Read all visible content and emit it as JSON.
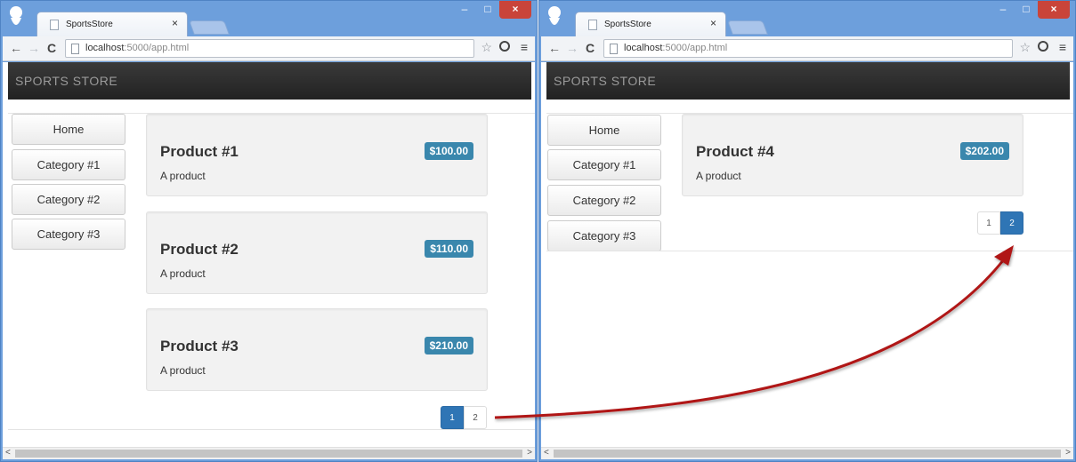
{
  "windows": [
    {
      "tab_title": "SportsStore",
      "url_host": "localhost",
      "url_rest": ":5000/app.html",
      "brand": "SPORTS STORE",
      "categories": [
        "Home",
        "Category #1",
        "Category #2",
        "Category #3"
      ],
      "products": [
        {
          "name": "Product #1",
          "description": "A product",
          "price": "$100.00"
        },
        {
          "name": "Product #2",
          "description": "A product",
          "price": "$110.00"
        },
        {
          "name": "Product #3",
          "description": "A product",
          "price": "$210.00"
        }
      ],
      "pages": [
        "1",
        "2"
      ],
      "active_page": "1"
    },
    {
      "tab_title": "SportsStore",
      "url_host": "localhost",
      "url_rest": ":5000/app.html",
      "brand": "SPORTS STORE",
      "categories": [
        "Home",
        "Category #1",
        "Category #2",
        "Category #3"
      ],
      "products": [
        {
          "name": "Product #4",
          "description": "A product",
          "price": "$202.00"
        }
      ],
      "pages": [
        "1",
        "2"
      ],
      "active_page": "2"
    }
  ],
  "glyphs": {
    "tab_close": "×",
    "minimize": "–",
    "maximize": "□",
    "close": "×",
    "back": "←",
    "forward": "→",
    "reload": "C",
    "star": "☆",
    "menu": "≡",
    "scroll_left": "<",
    "scroll_right": ">"
  },
  "colors": {
    "price_badge": "#3a87ad",
    "active_page": "#2f75b5",
    "arrow": "#b01818",
    "navbar": "#2a2a2a"
  }
}
